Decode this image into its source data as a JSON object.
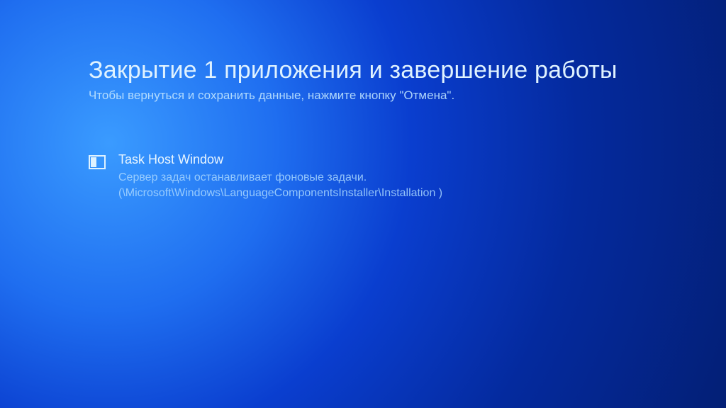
{
  "header": {
    "title": "Закрытие 1 приложения и завершение работы",
    "subtitle": "Чтобы вернуться и сохранить данные, нажмите кнопку \"Отмена\"."
  },
  "apps": [
    {
      "name": "Task Host Window",
      "description": "Сервер задач останавливает фоновые задачи. (\\Microsoft\\Windows\\LanguageComponentsInstaller\\Installation )"
    }
  ]
}
